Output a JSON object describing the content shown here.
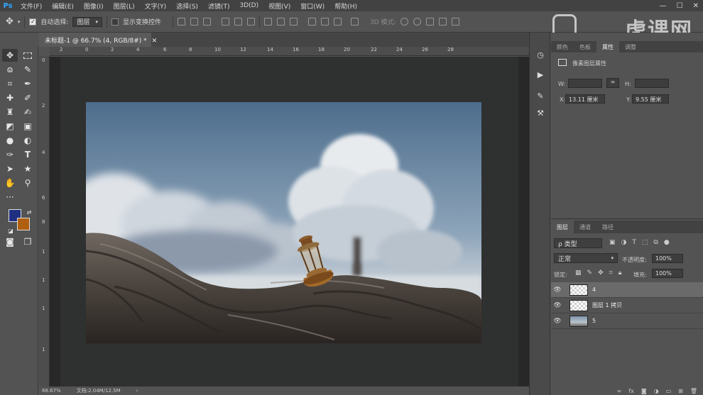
{
  "app": {
    "logo": "Ps"
  },
  "menubar": {
    "items": [
      "文件(F)",
      "编辑(E)",
      "图像(I)",
      "图层(L)",
      "文字(Y)",
      "选择(S)",
      "滤镜(T)",
      "3D(D)",
      "视图(V)",
      "窗口(W)",
      "帮助(H)"
    ],
    "window_controls": [
      "—",
      "☐",
      "✕"
    ]
  },
  "options": {
    "auto_select_label": "自动选择:",
    "auto_select_target": "图层",
    "transform_controls_label": "显示变换控件",
    "mode_3d_label": "3D 模式:",
    "watermark": "虎课网"
  },
  "document": {
    "tab_title": "未标题-1 @ 66.7% (4, RGB/8#) *",
    "zoom": "66.67%",
    "doc_info": "文档:2.04M/12.5M"
  },
  "ruler": {
    "top": [
      "2",
      "0",
      "2",
      "4",
      "6",
      "8",
      "10",
      "12",
      "14",
      "16",
      "18",
      "20",
      "22",
      "24",
      "26",
      "28"
    ],
    "left": [
      "0",
      "2",
      "4",
      "6",
      "8",
      "1",
      "1",
      "1",
      "1"
    ]
  },
  "colors": {
    "foreground": "#1f2f82",
    "background": "#b05f10"
  },
  "properties": {
    "tabs": [
      "颜色",
      "色板",
      "属性",
      "调整"
    ],
    "active_tab": 2,
    "header": "像素图层属性",
    "w_label": "W:",
    "w_value": "",
    "h_label": "H:",
    "h_value": "",
    "x_label": "X:",
    "x_value": "13.11 厘米",
    "y_label": "Y:",
    "y_value": "9.55 厘米"
  },
  "layers_panel": {
    "tabs": [
      "图层",
      "通道",
      "路径"
    ],
    "filter_label": "ρ 类型",
    "blend_mode": "正常",
    "opacity_label": "不透明度:",
    "opacity_value": "100%",
    "lock_label": "锁定:",
    "fill_label": "填充:",
    "fill_value": "100%",
    "layers": [
      {
        "name": "4",
        "thumb": "check",
        "selected": true
      },
      {
        "name": "图层 1 拷贝",
        "thumb": "check",
        "selected": false
      },
      {
        "name": "5",
        "thumb": "sky",
        "selected": false
      }
    ],
    "bottom_icons": [
      "link-icon",
      "fx-icon",
      "mask-icon",
      "adjustment-icon",
      "group-icon",
      "new-layer-icon",
      "trash-icon"
    ]
  }
}
